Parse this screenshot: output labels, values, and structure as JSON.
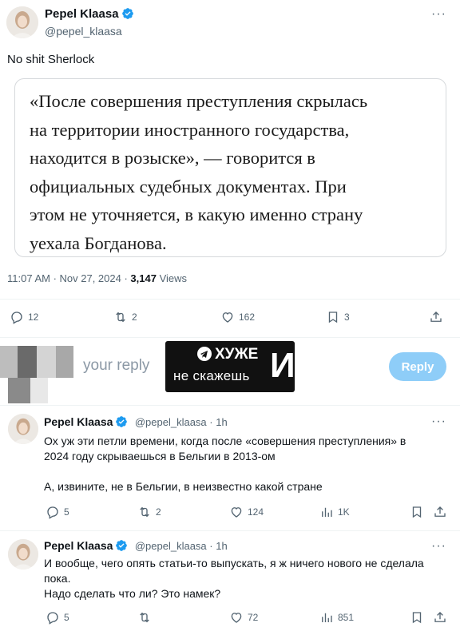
{
  "main_tweet": {
    "author_name": "Pepel Klaasa",
    "author_handle": "@pepel_klaasa",
    "more_label": "···",
    "text": "No shit Sherlock",
    "quote_lines": [
      "«После совершения преступления скрылась",
      "на территории иностранного государства,",
      "находится в розыске», — говорится в",
      "официальных судебных документах. При",
      "этом не уточняется, в какую именно страну",
      "уехала Богданова."
    ],
    "time": "11:07 AM · Nov 27, 2024 · ",
    "views_count": "3,147",
    "views_label": " Views",
    "actions": {
      "replies": "12",
      "reposts": "2",
      "likes": "162",
      "bookmarks": "3"
    }
  },
  "reply_composer": {
    "placeholder": "your reply",
    "button": "Reply"
  },
  "watermark": {
    "top": "ХУЖЕ",
    "bottom": "не скажешь",
    "big": "И"
  },
  "replies": [
    {
      "author_name": "Pepel Klaasa",
      "handle_time": "@pepel_klaasa · 1h",
      "more_label": "···",
      "lines": [
        "Ох уж эти петли времени, когда после «совершения преступления» в",
        "2024 году скрываешься в Бельгии в 2013-ом",
        "",
        "А, извините, не в Бельгии, в неизвестно какой стране"
      ],
      "actions": {
        "replies": "5",
        "reposts": "2",
        "likes": "124",
        "views": "1K"
      }
    },
    {
      "author_name": "Pepel Klaasa",
      "handle_time": "@pepel_klaasa · 1h",
      "more_label": "···",
      "lines": [
        "И вообще, чего опять статьи-то выпускать, я ж ничего нового не сделала",
        "пока.",
        "Надо сделать что ли? Это намек?"
      ],
      "actions": {
        "replies": "5",
        "reposts": "",
        "likes": "72",
        "views": "851"
      }
    }
  ],
  "colors": {
    "verified": "#1d9bf0",
    "muted": "#536471",
    "reply_button": "#8ecdf8"
  }
}
